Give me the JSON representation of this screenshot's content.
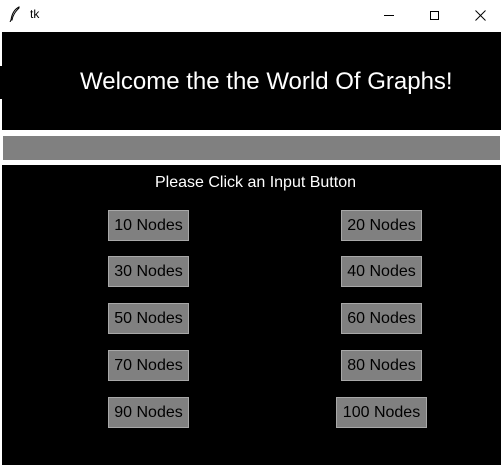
{
  "window": {
    "title": "tk",
    "app_icon": "feather-icon",
    "controls": [
      "minimize-icon",
      "maximize-icon",
      "close-icon"
    ]
  },
  "header": {
    "welcome": "Welcome the the World Of Graphs!"
  },
  "main": {
    "prompt": "Please Click an Input Button",
    "buttons": [
      {
        "label": "10 Nodes"
      },
      {
        "label": "20 Nodes"
      },
      {
        "label": "30 Nodes"
      },
      {
        "label": "40 Nodes"
      },
      {
        "label": "50 Nodes"
      },
      {
        "label": "60 Nodes"
      },
      {
        "label": "70 Nodes"
      },
      {
        "label": "80 Nodes"
      },
      {
        "label": "90 Nodes"
      },
      {
        "label": "100 Nodes"
      }
    ]
  },
  "colors": {
    "panel": "#000000",
    "button": "#808080",
    "bar": "#808080",
    "text_light": "#ffffff"
  }
}
